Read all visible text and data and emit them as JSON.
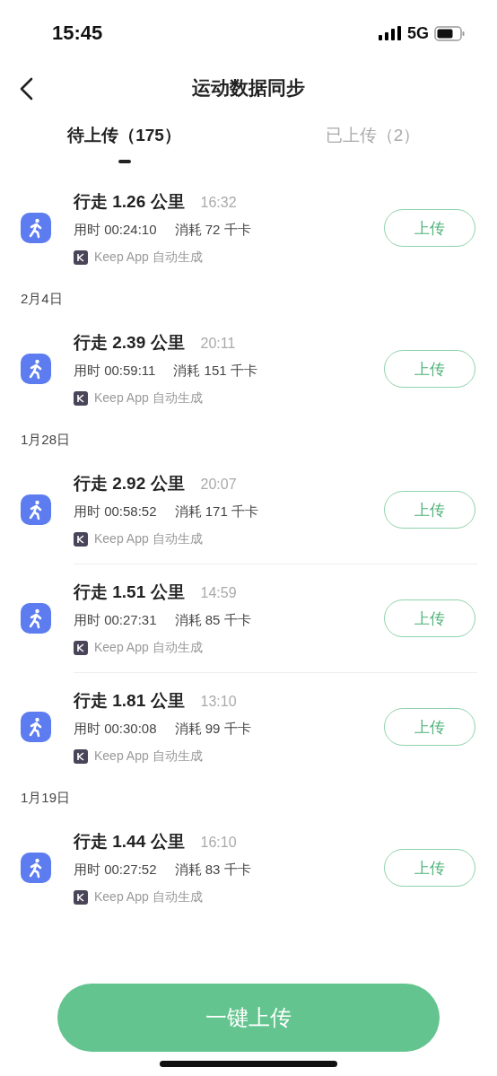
{
  "status_bar": {
    "time": "15:45",
    "network": "5G"
  },
  "header": {
    "title": "运动数据同步"
  },
  "tabs": [
    {
      "label": "待上传（175）",
      "selected": true
    },
    {
      "label": "已上传（2）",
      "selected": false
    }
  ],
  "groups": [
    {
      "records": [
        {
          "title": "行走 1.26 公里",
          "time": "16:32",
          "duration": "用时 00:24:10",
          "calories": "消耗 72 千卡",
          "source": "Keep App 自动生成",
          "button": "上传"
        }
      ]
    },
    {
      "date": "2月4日",
      "records": [
        {
          "title": "行走 2.39 公里",
          "time": "20:11",
          "duration": "用时 00:59:11",
          "calories": "消耗 151 千卡",
          "source": "Keep App 自动生成",
          "button": "上传"
        }
      ]
    },
    {
      "date": "1月28日",
      "records": [
        {
          "title": "行走 2.92 公里",
          "time": "20:07",
          "duration": "用时 00:58:52",
          "calories": "消耗 171 千卡",
          "source": "Keep App 自动生成",
          "button": "上传"
        },
        {
          "title": "行走 1.51 公里",
          "time": "14:59",
          "duration": "用时 00:27:31",
          "calories": "消耗 85 千卡",
          "source": "Keep App 自动生成",
          "button": "上传"
        },
        {
          "title": "行走 1.81 公里",
          "time": "13:10",
          "duration": "用时 00:30:08",
          "calories": "消耗 99 千卡",
          "source": "Keep App 自动生成",
          "button": "上传"
        }
      ]
    },
    {
      "date": "1月19日",
      "records": [
        {
          "title": "行走 1.44 公里",
          "time": "16:10",
          "duration": "用时 00:27:52",
          "calories": "消耗 83 千卡",
          "source": "Keep App 自动生成",
          "button": "上传"
        }
      ]
    }
  ],
  "upload_all_button": "一键上传"
}
